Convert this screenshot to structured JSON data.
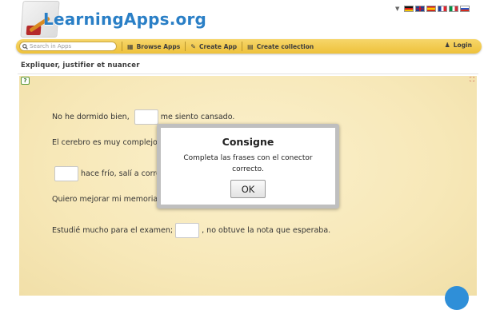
{
  "header": {
    "logo_text": "LearningApps.org",
    "language_flags": [
      "de-flag-icon",
      "gb-flag-icon",
      "es-flag-icon",
      "fr-flag-icon",
      "it-flag-icon",
      "ru-flag-icon"
    ]
  },
  "toolbar": {
    "search_placeholder": "Search in Apps",
    "browse_label": "Browse Apps",
    "create_label": "Create App",
    "collection_label": "Create collection",
    "login_label": "Login"
  },
  "page": {
    "title": "Expliquer, justifier et nuancer"
  },
  "exercise": {
    "sentences": [
      {
        "before": "No he dormido bien,",
        "after": "me siento cansado."
      },
      {
        "before": "El cerebro es muy complejo,",
        "after": ""
      },
      {
        "before": "",
        "after": "hace frío, salí a corre"
      },
      {
        "before": "Quiero mejorar mi memoria,",
        "after": ""
      },
      {
        "before": "Estudié mucho para el examen;",
        "after": ", no obtuve la nota que esperaba."
      }
    ]
  },
  "dialog": {
    "title": "Consigne",
    "text": "Completa las frases con el conector correcto.",
    "ok_label": "OK"
  },
  "colors": {
    "brand_blue": "#2a7fc6",
    "toolbar_yellow": "#eec13a",
    "app_background": "#f7e8b8"
  }
}
